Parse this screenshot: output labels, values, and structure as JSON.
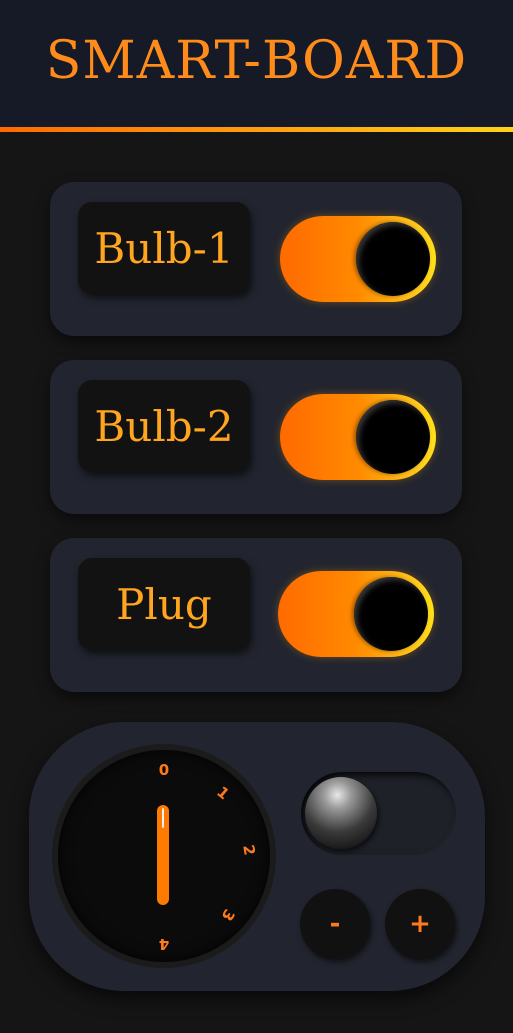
{
  "header": {
    "title": "SMART-BOARD"
  },
  "devices": [
    {
      "label": "Bulb-1",
      "state": "on"
    },
    {
      "label": "Bulb-2",
      "state": "on"
    },
    {
      "label": "Plug",
      "state": "on"
    }
  ],
  "dial": {
    "marks": [
      "0",
      "1",
      "2",
      "3",
      "4"
    ],
    "value": 0
  },
  "controls": {
    "minus_label": "-",
    "plus_label": "+",
    "slider_state": "off"
  },
  "colors": {
    "accent": "#ff8c1a",
    "card": "#22252f",
    "background": "#151515",
    "header": "#161a26"
  }
}
